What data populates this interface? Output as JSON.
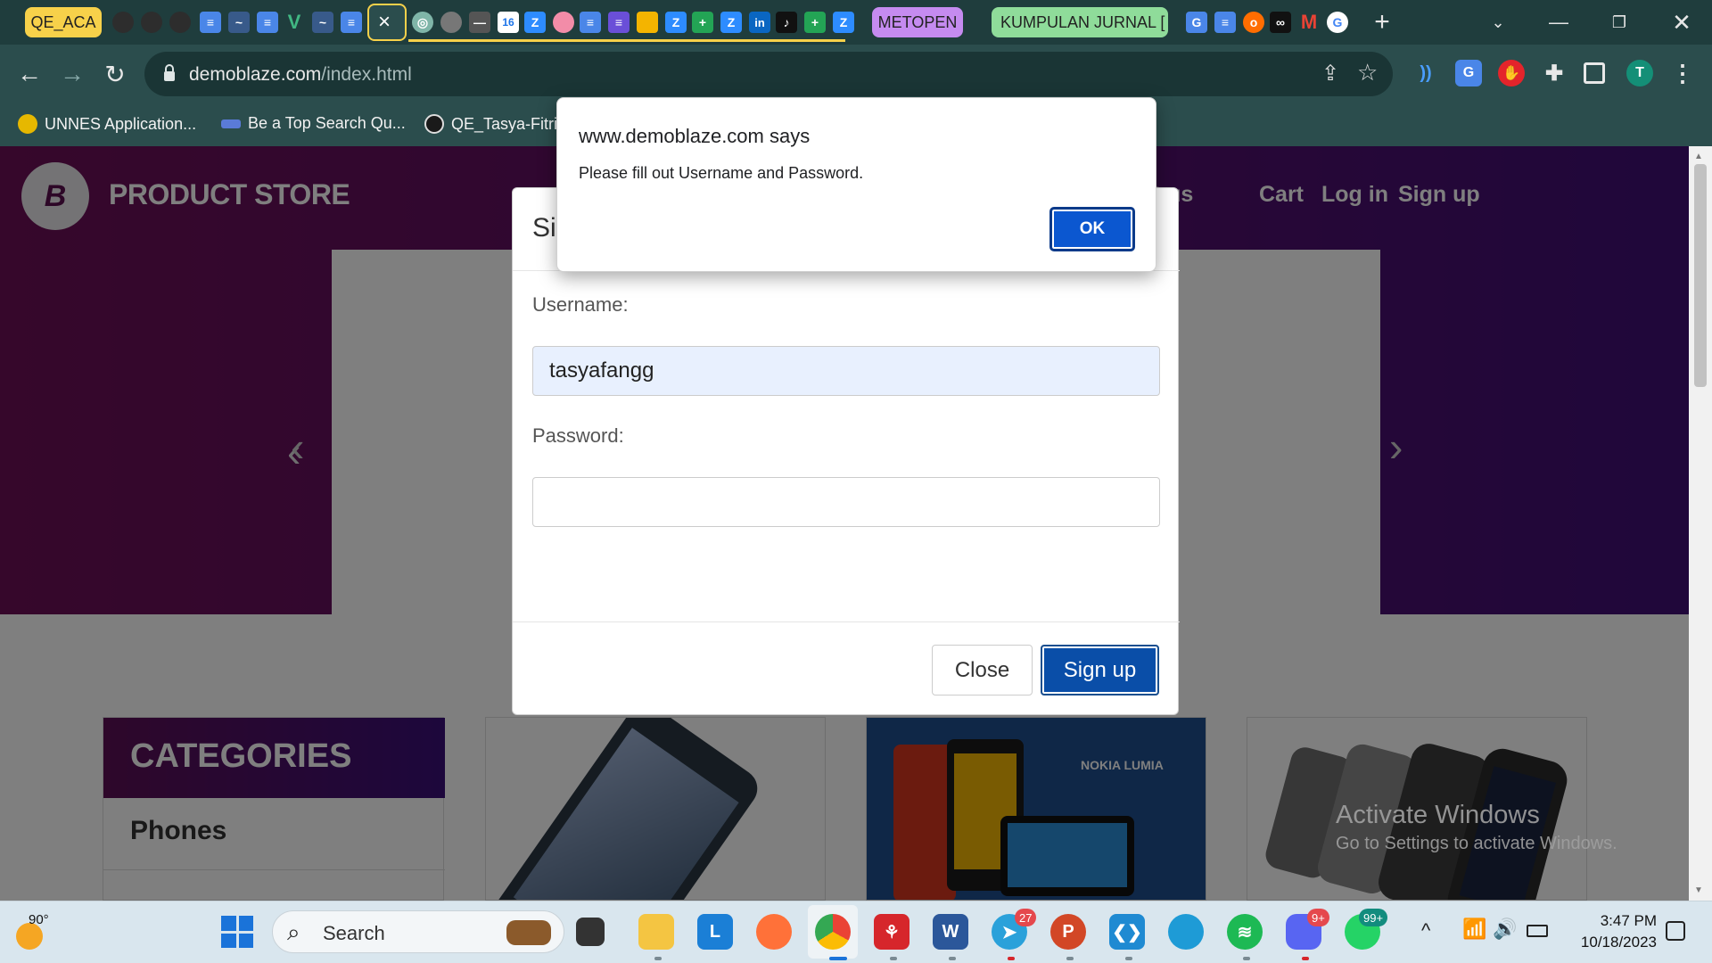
{
  "browser": {
    "tabs": [
      {
        "label": "QE_ACA",
        "bg": "#f7d14a",
        "fg": "#222"
      },
      {
        "label": "METOPEN",
        "bg": "#c58bf0",
        "fg": "#222"
      },
      {
        "label": "KUMPULAN JURNAL [",
        "bg": "#8fdc9a",
        "fg": "#222"
      }
    ],
    "active_tab_close": "×",
    "new_tab": "+",
    "address": {
      "domain": "demoblaze.com",
      "path": "/index.html"
    },
    "profile_initial": "T",
    "bookmarks": [
      {
        "label": "UNNES Application..."
      },
      {
        "label": "Be a Top Search Qu..."
      },
      {
        "label": "QE_Tasya-Fitria"
      }
    ]
  },
  "page": {
    "brand": "PRODUCT STORE",
    "brand_logo": "B",
    "nav": [
      "About us",
      "Cart",
      "Log in",
      "Sign up"
    ],
    "categories_title": "CATEGORIES",
    "categories": [
      "Phones"
    ],
    "card_nokia_label": "NOKIA LUMIA",
    "watermark": {
      "line1": "Activate Windows",
      "line2": "Go to Settings to activate Windows."
    }
  },
  "modal": {
    "title": "Sign up",
    "username_label": "Username:",
    "username_value": "tasyafangg",
    "password_label": "Password:",
    "password_value": "",
    "close_label": "Close",
    "submit_label": "Sign up"
  },
  "alert": {
    "title": "www.demoblaze.com says",
    "message": "Please fill out Username and Password.",
    "ok_label": "OK"
  },
  "taskbar": {
    "weather_temp": "90°",
    "search_placeholder": "Search",
    "badges": {
      "telegram": "27",
      "discord": "9+",
      "whatsapp": "99+"
    },
    "time": "3:47 PM",
    "date": "10/18/2023"
  }
}
